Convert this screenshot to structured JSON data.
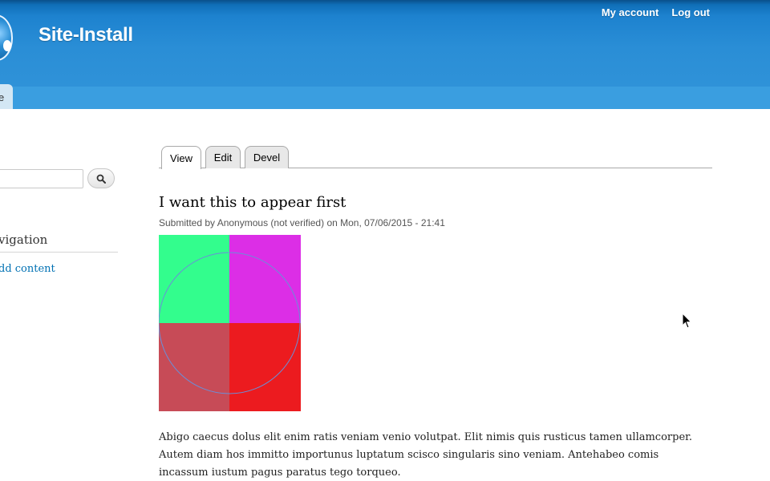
{
  "header": {
    "site_name": "Site-Install",
    "secondary_menu": [
      "My account",
      "Log out"
    ],
    "main_menu_tab_fragment": "e",
    "colors": {
      "header_blue": "#2a8ed6",
      "header_dark": "#0a4f8a",
      "link": "#0071b3"
    }
  },
  "sidebar": {
    "search_icon": "search-icon",
    "navigation_title_fragment": "vigation",
    "add_content_fragment": "dd content"
  },
  "tabs": [
    {
      "label": "View",
      "active": true
    },
    {
      "label": "Edit",
      "active": false
    },
    {
      "label": "Devel",
      "active": false
    }
  ],
  "node": {
    "title": "I want this to appear first",
    "submitted": "Submitted by Anonymous (not verified) on Mon, 07/06/2015 - 21:41",
    "image": {
      "quadrant_colors": [
        "#33fd8d",
        "#dc2ee6",
        "#c74b57",
        "#ec1b1f"
      ],
      "circle_color": "#6a8fd8"
    },
    "body": "Abigo caecus dolus elit enim ratis veniam venio volutpat. Elit nimis quis rusticus tamen ullamcorper. Autem diam hos immitto importunus luptatum scisco singularis sino veniam. Antehabeo comis incassum iustum pagus paratus tego torqueo."
  }
}
